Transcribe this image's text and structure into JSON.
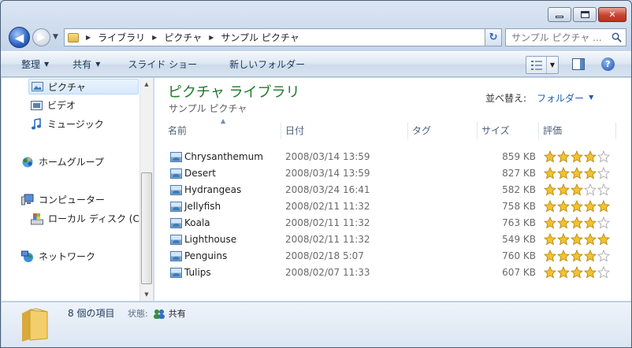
{
  "window": {
    "close": "✕"
  },
  "address": {
    "crumbs": [
      "ライブラリ",
      "ピクチャ",
      "サンプル ピクチャ"
    ],
    "search_placeholder": "サンプル ピクチャ ..."
  },
  "toolbar": {
    "organize": "整理",
    "share": "共有",
    "slideshow": "スライド ショー",
    "new_folder": "新しいフォルダー",
    "help": "?"
  },
  "nav": {
    "items": [
      {
        "label": "ピクチャ",
        "icon": "pictures-icon",
        "selected": true
      },
      {
        "label": "ビデオ",
        "icon": "video-icon"
      },
      {
        "label": "ミュージック",
        "icon": "music-icon"
      },
      {
        "label": "ホームグループ",
        "icon": "homegroup-icon"
      },
      {
        "label": "コンピューター",
        "icon": "computer-icon"
      },
      {
        "label": "ローカル ディスク (C",
        "icon": "local-disk-icon"
      },
      {
        "label": "ネットワーク",
        "icon": "network-icon"
      }
    ]
  },
  "content": {
    "title": "ピクチャ ライブラリ",
    "subtitle": "サンプル ピクチャ",
    "arrange_label": "並べ替え:",
    "arrange_value": "フォルダー",
    "columns": [
      "名前",
      "日付",
      "タグ",
      "サイズ",
      "評価"
    ],
    "files": [
      {
        "name": "Chrysanthemum",
        "date": "2008/03/14 13:59",
        "size": "859 KB",
        "rating": 4
      },
      {
        "name": "Desert",
        "date": "2008/03/14 13:59",
        "size": "827 KB",
        "rating": 4
      },
      {
        "name": "Hydrangeas",
        "date": "2008/03/24 16:41",
        "size": "582 KB",
        "rating": 3
      },
      {
        "name": "Jellyfish",
        "date": "2008/02/11 11:32",
        "size": "758 KB",
        "rating": 5
      },
      {
        "name": "Koala",
        "date": "2008/02/11 11:32",
        "size": "763 KB",
        "rating": 4
      },
      {
        "name": "Lighthouse",
        "date": "2008/02/11 11:32",
        "size": "549 KB",
        "rating": 5
      },
      {
        "name": "Penguins",
        "date": "2008/02/18 5:07",
        "size": "760 KB",
        "rating": 4
      },
      {
        "name": "Tulips",
        "date": "2008/02/07 11:33",
        "size": "607 KB",
        "rating": 4
      }
    ]
  },
  "details": {
    "count": "8 個の項目",
    "state_label": "状態:",
    "state_value": "共有"
  },
  "colors": {
    "title_green": "#1e7a2b",
    "link_blue": "#1e5cb3",
    "star_gold": "#f2c230"
  }
}
